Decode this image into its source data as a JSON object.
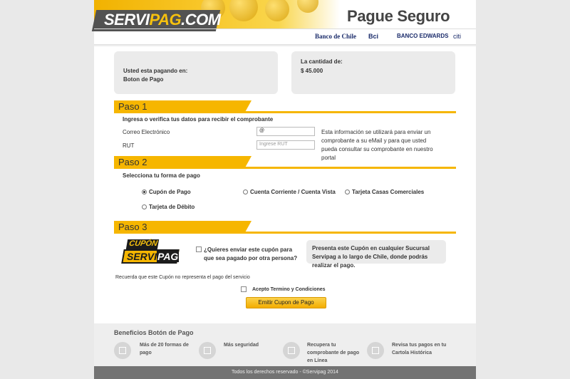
{
  "header": {
    "logo_serv": "SERVI",
    "logo_pag": "PAG",
    "logo_com": ".COM",
    "title": "Pague Seguro",
    "banks": [
      "Banco de Chile",
      "Bci",
      "BANCO EDWARDS",
      "citi"
    ]
  },
  "info": {
    "left_line1": "Usted esta pagando en:",
    "left_line2": "Boton de Pago",
    "right_line1": "La cantidad de:",
    "right_line2": "$ 45.000"
  },
  "paso1": {
    "title": "Paso 1",
    "subtitle": "Ingresa o verifica tus datos para recibir el comprobante",
    "email_label": "Correo Electrónico",
    "email_value": "@",
    "rut_label": "RUT",
    "rut_placeholder": "Ingrese RUT",
    "note": "Esta información se utilizará para enviar un comprobante a su eMail y para que usted pueda consultar su comprobante en nuestro portal"
  },
  "paso2": {
    "title": "Paso 2",
    "subtitle": "Selecciona tu forma de pago",
    "options": [
      "Cupón de Pago",
      "Cuenta Corriente / Cuenta Vista",
      "Tarjeta Casas Comerciales",
      "Tarjeta de Débito"
    ],
    "selected": "Cupón de Pago"
  },
  "paso3": {
    "title": "Paso 3",
    "cupon_top": "CUPÓN",
    "cupon_serv": "SERVI",
    "cupon_pag": "PAG",
    "question": "¿Quieres enviar este cupón para que sea pagado por otra persona?",
    "info": "Presenta este Cupón en cualquier Sucursal Servipag a lo largo de Chile, donde podrás realizar el pago.",
    "reminder": "Recuerda que este Cupón no representa el pago del servicio",
    "terms": "Acepto Termino y Condiciones",
    "button": "Emitir Cupon de Pago"
  },
  "benefits": {
    "title": "Beneficios Botón de Pago",
    "items": [
      "Más de 20 formas de pago",
      "Más seguridad",
      "Recupera tu comprobante de pago en Línea",
      "Revisa tus pagos en tu Cartola Histórica"
    ]
  },
  "footer": {
    "text": "Todos los derechos reservado - ©Servipag 2014"
  },
  "colors": {
    "accent": "#f6b600",
    "footer": "#737373"
  }
}
